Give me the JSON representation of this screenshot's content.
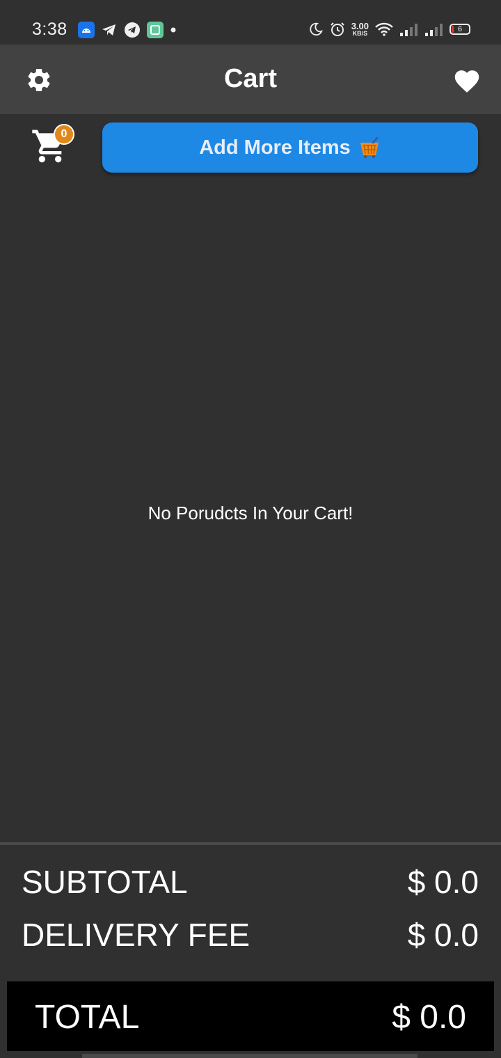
{
  "status_bar": {
    "time": "3:38",
    "speed_value": "3.00",
    "speed_unit": "KB/S",
    "battery": "6"
  },
  "app_bar": {
    "title": "Cart"
  },
  "cart": {
    "badge_count": "0",
    "add_more_label": "Add More Items",
    "empty_message": "No Porudcts In Your Cart!"
  },
  "summary": {
    "subtotal_label": "SUBTOTAL",
    "subtotal_value": "$ 0.0",
    "delivery_label": "DELIVERY FEE",
    "delivery_value": "$ 0.0",
    "total_label": "TOTAL",
    "total_value": "$ 0.0"
  },
  "colors": {
    "background": "#303030",
    "app_bar": "#424242",
    "accent_button": "#1e88e5",
    "badge": "#e0891b",
    "total_bar": "#000000"
  },
  "icons": {
    "settings": "gear-icon",
    "favorite": "heart-icon",
    "cart": "cart-icon",
    "basket": "shopping-basket-icon"
  }
}
